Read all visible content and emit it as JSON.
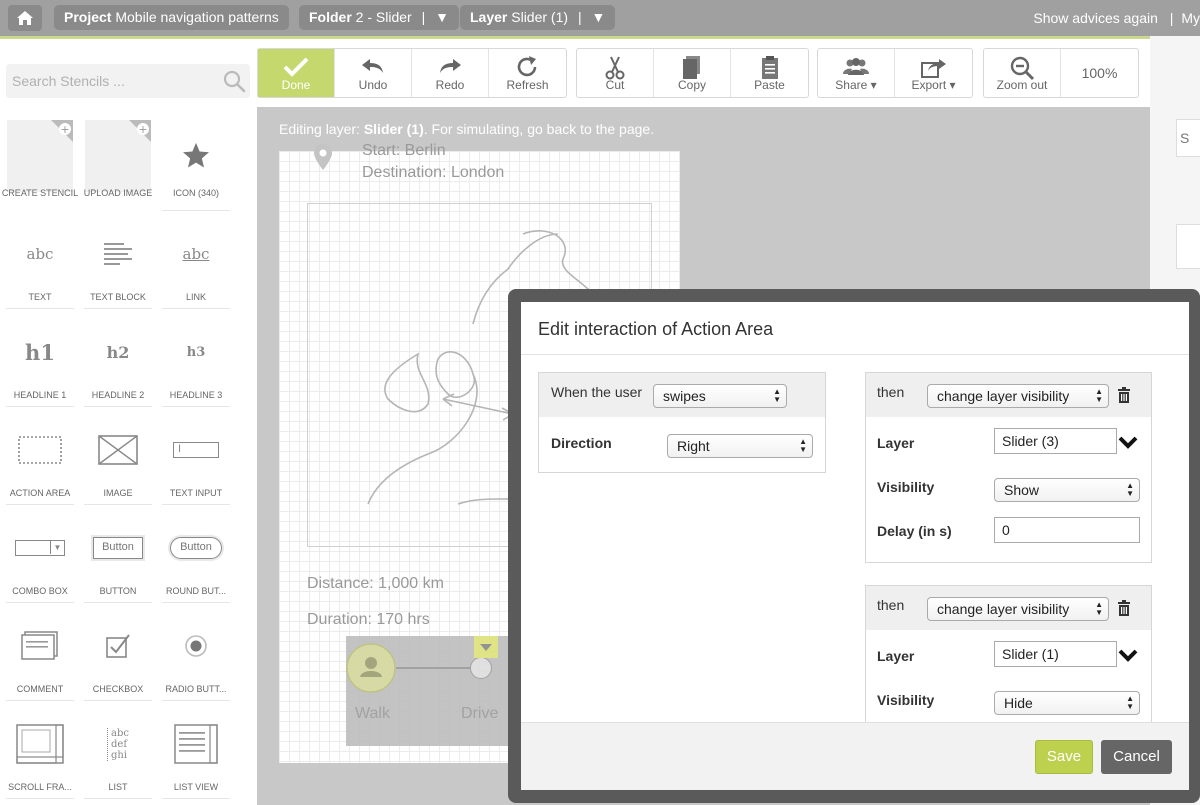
{
  "topbar": {
    "project_label": "Project",
    "project_name": "Mobile navigation patterns",
    "folder_label": "Folder",
    "folder_name": "2 - Slider",
    "folder_sep": "|",
    "folder_arrow": "▼",
    "layer_label": "Layer",
    "layer_name": "Slider (1)",
    "layer_sep": "|",
    "layer_arrow": "▼",
    "advices": "Show advices again",
    "right_sep": "|",
    "my": "My"
  },
  "stencils": {
    "search_placeholder": "Search Stencils ...",
    "items": [
      {
        "label": "CREATE STENCIL",
        "icon": "create-stencil-icon"
      },
      {
        "label": "UPLOAD IMAGE",
        "icon": "upload-image-icon"
      },
      {
        "label": "ICON (340)",
        "icon": "star-icon"
      },
      {
        "label": "TEXT",
        "icon": "text-icon",
        "glyph": "abc"
      },
      {
        "label": "TEXT BLOCK",
        "icon": "text-block-icon"
      },
      {
        "label": "LINK",
        "icon": "link-icon",
        "glyph": "abc"
      },
      {
        "label": "HEADLINE 1",
        "icon": "headline1-icon",
        "glyph": "h1"
      },
      {
        "label": "HEADLINE 2",
        "icon": "headline2-icon",
        "glyph": "h2"
      },
      {
        "label": "HEADLINE 3",
        "icon": "headline3-icon",
        "glyph": "h3"
      },
      {
        "label": "ACTION AREA",
        "icon": "action-area-icon"
      },
      {
        "label": "IMAGE",
        "icon": "image-icon"
      },
      {
        "label": "TEXT INPUT",
        "icon": "text-input-icon",
        "glyph": "I"
      },
      {
        "label": "COMBO BOX",
        "icon": "combo-box-icon",
        "glyph": "▼"
      },
      {
        "label": "BUTTON",
        "icon": "button-icon",
        "glyph": "Button"
      },
      {
        "label": "ROUND BUT...",
        "icon": "round-button-icon",
        "glyph": "Button"
      },
      {
        "label": "COMMENT",
        "icon": "comment-icon"
      },
      {
        "label": "CHECKBOX",
        "icon": "checkbox-icon"
      },
      {
        "label": "RADIO BUTT...",
        "icon": "radio-button-icon"
      },
      {
        "label": "SCROLL FRA...",
        "icon": "scroll-frame-icon"
      },
      {
        "label": "LIST",
        "icon": "list-icon",
        "glyph": [
          "abc",
          "def",
          "ghi"
        ]
      },
      {
        "label": "LIST VIEW",
        "icon": "list-view-icon"
      }
    ]
  },
  "toolbar": {
    "done": "Done",
    "undo": "Undo",
    "redo": "Redo",
    "refresh": "Refresh",
    "cut": "Cut",
    "copy": "Copy",
    "paste": "Paste",
    "share": "Share",
    "export": "Export",
    "zoom_out": "Zoom out",
    "zoom": "100%",
    "dropdown_arrow": "▾"
  },
  "canvas": {
    "editing_prefix": "Editing layer: ",
    "editing_layer": "Slider (1)",
    "editing_suffix": ". For simulating, go back to the page.",
    "start": "Start: Berlin",
    "destination": "Destination: London",
    "distance": "Distance: 1,000 km",
    "duration": "Duration: 170 hrs",
    "walk": "Walk",
    "drive": "Drive"
  },
  "modal": {
    "title": "Edit interaction of Action Area",
    "trigger": {
      "when_label": "When the user",
      "when_value": "swipes",
      "direction_label": "Direction",
      "direction_value": "Right"
    },
    "actions": [
      {
        "then_label": "then",
        "action": "change layer visibility",
        "layer_label": "Layer",
        "layer_value": "Slider (3)",
        "visibility_label": "Visibility",
        "visibility_value": "Show",
        "delay_label": "Delay (in s)",
        "delay_value": "0"
      },
      {
        "then_label": "then",
        "action": "change layer visibility",
        "layer_label": "Layer",
        "layer_value": "Slider (1)",
        "visibility_label": "Visibility",
        "visibility_value": "Hide"
      }
    ],
    "save": "Save",
    "cancel": "Cancel"
  },
  "colors": {
    "accent_green": "#c5d86d",
    "save_green": "#bdd14e",
    "topbar_gray": "#a0a0a0"
  }
}
